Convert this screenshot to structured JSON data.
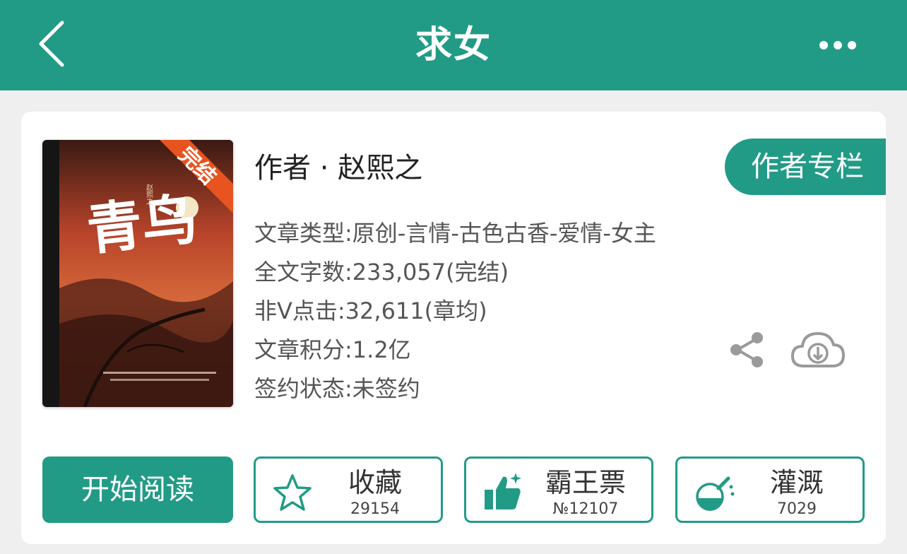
{
  "header": {
    "title": "求女"
  },
  "book": {
    "cover": {
      "badge": "完结",
      "title_art": "青鸟",
      "author_vertical": "赵熙之"
    },
    "author_line": "作者 · 赵熙之",
    "author_column_button": "作者专栏",
    "meta": {
      "genre": "文章类型:原创-言情-古色古香-爱情-女主",
      "word_count": "全文字数:233,057(完结)",
      "clicks": "非V点击:32,611(章均)",
      "score": "文章积分:1.2亿",
      "contract": "签约状态:未签约"
    }
  },
  "actions": {
    "read": "开始阅读",
    "favorite": {
      "label": "收藏",
      "count": "29154"
    },
    "vote": {
      "label": "霸王票",
      "count": "№12107"
    },
    "water": {
      "label": "灌溉",
      "count": "7029"
    }
  },
  "colors": {
    "accent": "#229b86",
    "icon_gray": "#9a9a9a"
  },
  "icons": [
    "back-arrow-icon",
    "more-dots-icon",
    "share-icon",
    "cloud-download-icon",
    "star-icon",
    "thumbs-up-icon",
    "flask-icon"
  ]
}
